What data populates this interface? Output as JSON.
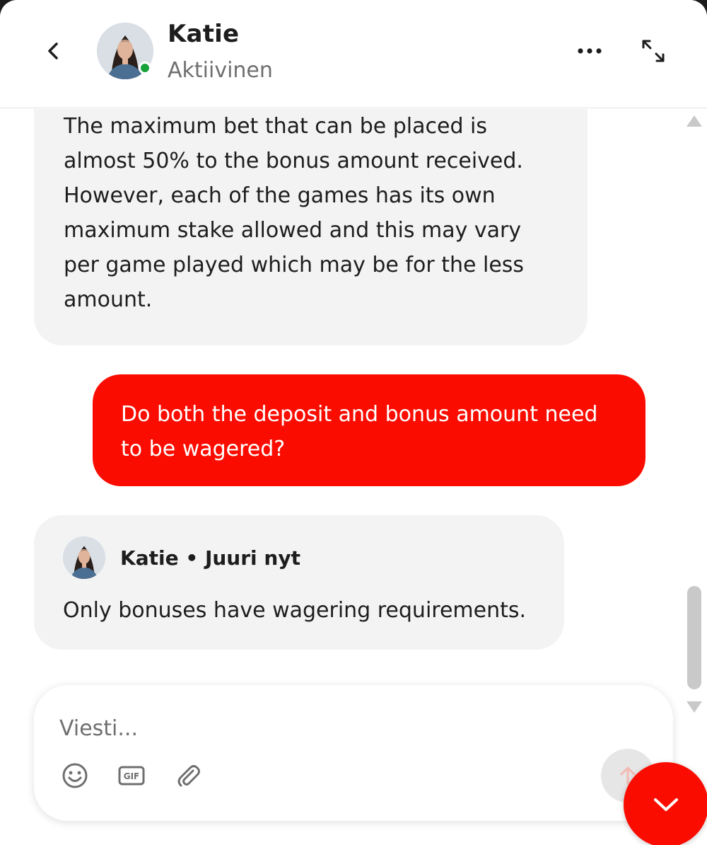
{
  "header": {
    "agent_name": "Katie",
    "agent_status": "Aktiivinen",
    "status_color": "#18a33a"
  },
  "messages": [
    {
      "from": "agent",
      "text": "The maximum bet that can be placed is almost 50% to the bonus amount received. However, each of the games has its own maximum stake allowed and this may vary per game played which may be for the less amount."
    },
    {
      "from": "user",
      "text": "Do both the deposit and bonus amount need to be wagered?"
    },
    {
      "from": "agent",
      "meta": "Katie • Juuri nyt",
      "text": "Only bonuses have wagering requirements."
    }
  ],
  "composer": {
    "placeholder": "Viesti...",
    "gif_label": "GIF"
  },
  "colors": {
    "accent": "#fa0d00",
    "agent_bubble": "#f3f3f3",
    "muted_text": "#6f6f6f"
  },
  "icons": {
    "back": "chevron-left-icon",
    "more": "more-horizontal-icon",
    "expand": "expand-icon",
    "emoji": "emoji-icon",
    "gif": "gif-icon",
    "attach": "paperclip-icon",
    "send": "arrow-up-icon",
    "minimize": "chevron-down-icon"
  }
}
